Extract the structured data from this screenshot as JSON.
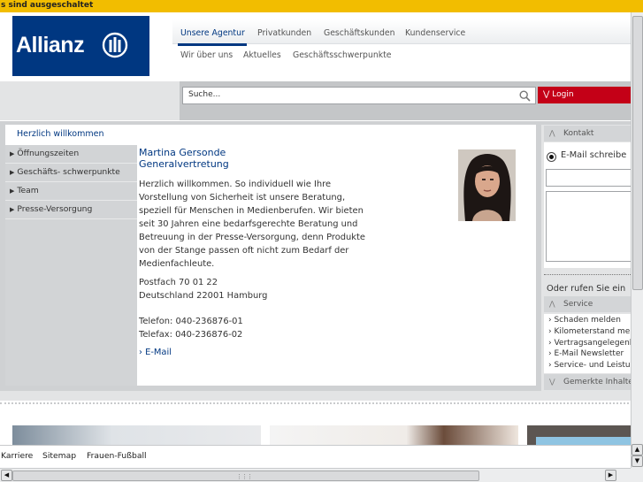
{
  "notice": "s sind ausgeschaltet",
  "logo": {
    "text": "Allianz"
  },
  "top_nav": {
    "primary": [
      "Unsere Agentur",
      "Privatkunden",
      "Geschäftskunden",
      "Kundenservice"
    ],
    "secondary": [
      "Wir über uns",
      "Aktuelles",
      "Geschäftsschwerpunkte"
    ]
  },
  "search": {
    "placeholder": "Suche..."
  },
  "login_label": "Login",
  "welcome_label": "Herzlich willkommen",
  "left_nav": [
    "Öffnungszeiten",
    "Geschäfts- schwerpunkte",
    "Team",
    "Presse-Versorgung"
  ],
  "content": {
    "name": "Martina Gersonde",
    "role": "Generalvertretung",
    "body_lines": [
      "Herzlich willkommen. So individuell wie Ihre",
      "Vorstellung von Sicherheit ist unsere Beratung,",
      "speziell für Menschen in Medienberufen. Wir bieten",
      "seit 30 Jahren eine bedarfsgerechte Beratung und",
      "Betreuung in der Presse-Versorgung, denn Produkte",
      "von der Stange passen oft nicht zum Bedarf der",
      "Medienfachleute."
    ],
    "address_lines": [
      "Postfach 70 01 22",
      "Deutschland 22001 Hamburg"
    ],
    "phone": "Telefon: 040-236876-01",
    "fax": "Telefax: 040-236876-02",
    "email_link": "E-Mail"
  },
  "sidebar": {
    "kontakt_title": "Kontakt",
    "email_option": "E-Mail schreibe",
    "or_call": "Oder rufen Sie ein",
    "service_title": "Service",
    "service_links": [
      "Schaden melden",
      "Kilometerstand mel",
      "Vertragsangelegenh",
      "E-Mail Newsletter",
      "Service- und Leistun"
    ],
    "related_title": "Gemerkte Inhalte"
  },
  "footer_links": [
    "Karriere",
    "Sitemap",
    "Frauen-Fußball"
  ],
  "colors": {
    "brand": "#003781",
    "login": "#c40017",
    "notice": "#f2bd00"
  }
}
